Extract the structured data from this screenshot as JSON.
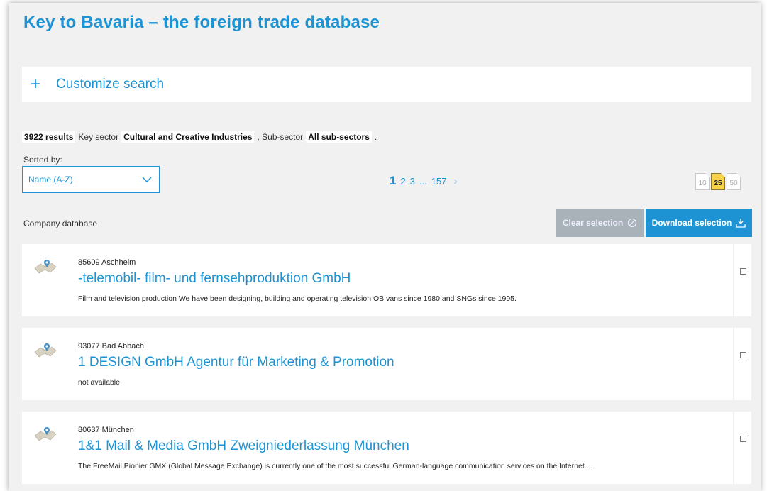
{
  "page": {
    "title": "Key to Bavaria – the foreign trade database",
    "customize_icon": "+",
    "customize_label": "Customize search"
  },
  "summary": {
    "results": "3922 results",
    "key_sector_label": "Key sector",
    "key_sector": "Cultural and Creative Industries",
    "sub_sector_label": ", Sub-sector",
    "sub_sector": "All sub-sectors",
    "end": "."
  },
  "sort": {
    "label": "Sorted by:",
    "value": "Name (A-Z)"
  },
  "pagination": {
    "current": "1",
    "pages": [
      "2",
      "3"
    ],
    "ellipsis": "...",
    "last": "157",
    "next": "›"
  },
  "per_page": {
    "options": [
      "10",
      "25",
      "50"
    ],
    "selected": "25"
  },
  "database": {
    "label": "Company database",
    "clear_label": "Clear selection",
    "download_label": "Download selection"
  },
  "companies": [
    {
      "location": "85609 Aschheim",
      "name": "-telemobil- film- und fernsehproduktion GmbH",
      "description": "Film and television production We have been designing, building and operating television OB vans since 1980 and SNGs since 1995."
    },
    {
      "location": "93077 Bad Abbach",
      "name": "1 DESIGN GmbH Agentur für Marketing & Promotion",
      "description": "not available"
    },
    {
      "location": "80637 München",
      "name": "1&1 Mail & Media GmbH Zweigniederlassung München",
      "description": "The FreeMail Pionier GMX (Global Message Exchange) is currently one of the most successful German-language communication services on the Internet...."
    }
  ],
  "colors": {
    "accent": "#1e93d3",
    "background": "#f1f1f1",
    "active_page_size": "#f7d24a",
    "disabled_button": "#a8b2b8"
  }
}
